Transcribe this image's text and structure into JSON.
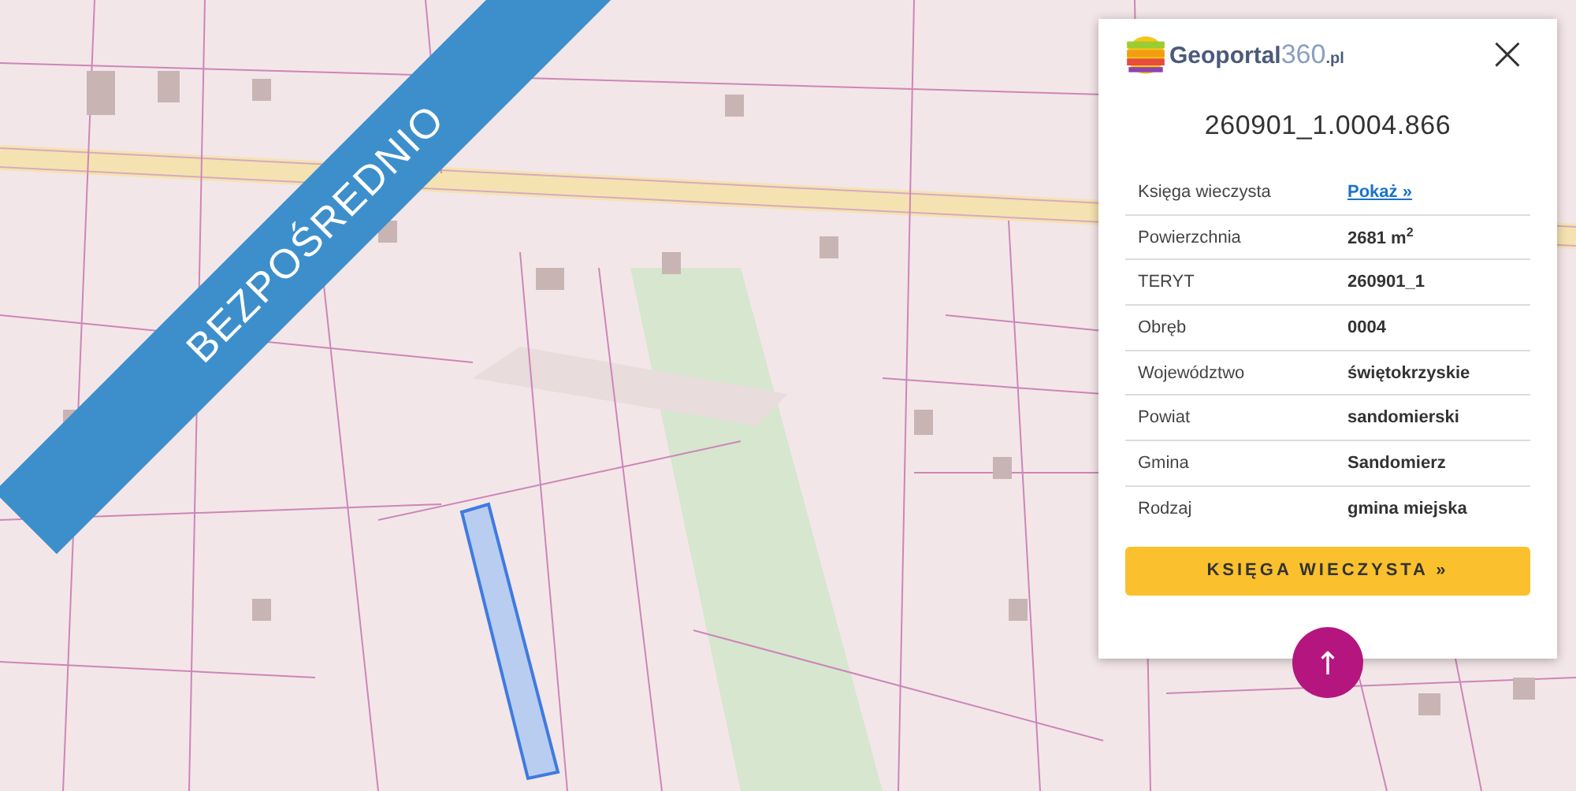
{
  "ribbon": {
    "label": "BEZPOŚREDNIO"
  },
  "panel": {
    "logo": {
      "name": "Geoportal",
      "number": "360",
      "suffix": ".pl"
    },
    "close": "×",
    "parcel_id": "260901_1.0004.866",
    "rows": [
      {
        "label": "Księga wieczysta",
        "value": "Pokaż »",
        "kind": "link"
      },
      {
        "label": "Powierzchnia",
        "value": "2681 m$^{2}$",
        "kind": "text"
      },
      {
        "label": "TERYT",
        "value": "260901_1",
        "kind": "text"
      },
      {
        "label": "Obręb",
        "value": "0004",
        "kind": "text"
      },
      {
        "label": "Województwo",
        "value": "świętokrzyskie",
        "kind": "text"
      },
      {
        "label": "Powiat",
        "value": "sandomierski",
        "kind": "text"
      },
      {
        "label": "Gmina",
        "value": "Sandomierz",
        "kind": "text"
      },
      {
        "label": "Rodzaj",
        "value": "gmina miejska",
        "kind": "text"
      }
    ],
    "button": "KSIĘGA WIECZYSTA »"
  },
  "scroll_top": {
    "label": "↑"
  }
}
